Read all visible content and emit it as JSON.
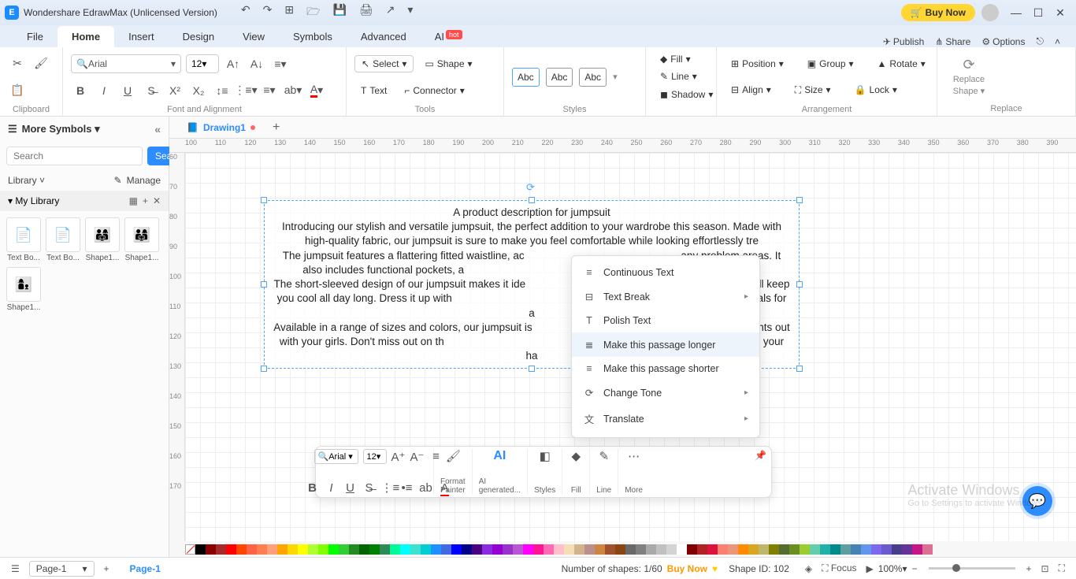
{
  "titlebar": {
    "app_title": "Wondershare EdrawMax (Unlicensed Version)",
    "buy_now": "Buy Now"
  },
  "menu": {
    "tabs": [
      "File",
      "Home",
      "Insert",
      "Design",
      "View",
      "Symbols",
      "Advanced",
      "AI"
    ],
    "active_index": 1,
    "hot_index": 7,
    "publish": "Publish",
    "share": "Share",
    "options": "Options"
  },
  "ribbon": {
    "clipboard": "Clipboard",
    "font_align": "Font and Alignment",
    "tools": "Tools",
    "styles": "Styles",
    "arrangement": "Arrangement",
    "replace_grp": "Replace",
    "font_name": "Arial",
    "font_size": "12",
    "select": "Select",
    "shape": "Shape",
    "text": "Text",
    "connector": "Connector",
    "abc": "Abc",
    "fill": "Fill",
    "line": "Line",
    "shadow": "Shadow",
    "position": "Position",
    "align": "Align",
    "group": "Group",
    "size": "Size",
    "rotate": "Rotate",
    "lock": "Lock",
    "replace_shape_l1": "Replace",
    "replace_shape_l2": "Shape"
  },
  "left_panel": {
    "title": "More Symbols",
    "search_btn": "Search",
    "search_placeholder": "Search",
    "library": "Library",
    "manage": "Manage",
    "my_library": "My Library",
    "thumbs": [
      "Text Bo...",
      "Text Bo...",
      "Shape1...",
      "Shape1...",
      "Shape1..."
    ]
  },
  "doc_tabs": {
    "name": "Drawing1"
  },
  "ruler_h": [
    "100",
    "110",
    "120",
    "130",
    "140",
    "150",
    "160",
    "170",
    "180",
    "190",
    "200",
    "210",
    "220",
    "230",
    "240",
    "250",
    "260",
    "270",
    "280",
    "290",
    "300",
    "310",
    "320",
    "330",
    "340",
    "350",
    "360",
    "370",
    "380",
    "390"
  ],
  "ruler_v": [
    "60",
    "70",
    "80",
    "90",
    "100",
    "110",
    "120",
    "130",
    "140",
    "150",
    "160",
    "170"
  ],
  "text_content": {
    "title": "A product description for jumpsuit",
    "p1": "Introducing our stylish and versatile jumpsuit, the perfect addition to your wardrobe this season. Made with high-quality fabric, our jumpsuit is sure to make you feel comfortable while looking effortlessly tre",
    "p2": "The jumpsuit features a flattering fitted waistline, ac                                                     any problem areas. It also includes functional pockets, a                                                  tials without having to lug aroun",
    "p3": "The short-sleeved design of our jumpsuit makes it ide                                                    hable material will keep you cool all day long. Dress it up with                                                 ght out or keep it casual with sandals for a",
    "p4": "Available in a range of sizes and colors, our jumpsuit is                                                  pping trips to nights out with your girls. Don't miss out on th                                                   and comfort to your wardrobe – get your ha"
  },
  "ctx_menu": {
    "continuous": "Continuous Text",
    "text_break": "Text Break",
    "polish": "Polish Text",
    "longer": "Make this passage longer",
    "shorter": "Make this passage shorter",
    "change_tone": "Change Tone",
    "translate": "Translate"
  },
  "float_tb": {
    "font": "Arial",
    "size": "12",
    "format_painter": "Format\nPainter",
    "ai_gen": "AI\ngenerated...",
    "styles": "Styles",
    "fill": "Fill",
    "line": "Line",
    "more": "More"
  },
  "statusbar": {
    "page_sel": "Page-1",
    "page_tab": "Page-1",
    "shapes_count": "Number of shapes: 1/60",
    "buy_now": "Buy Now",
    "shape_id": "Shape ID: 102",
    "focus": "Focus",
    "zoom": "100%"
  },
  "watermark": {
    "l1": "Activate Windows",
    "l2": "Go to Settings to activate Windows."
  },
  "colors": [
    "#000000",
    "#8B0000",
    "#A52A2A",
    "#FF0000",
    "#FF4500",
    "#FF6347",
    "#FF7F50",
    "#FFA07A",
    "#FFA500",
    "#FFD700",
    "#FFFF00",
    "#ADFF2F",
    "#7FFF00",
    "#00FF00",
    "#32CD32",
    "#228B22",
    "#006400",
    "#008000",
    "#2E8B57",
    "#00FA9A",
    "#00FFFF",
    "#40E0D0",
    "#00CED1",
    "#1E90FF",
    "#4169E1",
    "#0000FF",
    "#00008B",
    "#4B0082",
    "#8A2BE2",
    "#9400D3",
    "#9932CC",
    "#BA55D3",
    "#FF00FF",
    "#FF1493",
    "#FF69B4",
    "#FFC0CB",
    "#F5DEB3",
    "#D2B48C",
    "#BC8F8F",
    "#CD853F",
    "#A0522D",
    "#8B4513",
    "#696969",
    "#808080",
    "#A9A9A9",
    "#C0C0C0",
    "#D3D3D3",
    "#FFFFFF",
    "#800000",
    "#B22222",
    "#DC143C",
    "#FA8072",
    "#E9967A",
    "#FF8C00",
    "#DAA520",
    "#BDB76B",
    "#808000",
    "#556B2F",
    "#6B8E23",
    "#9ACD32",
    "#66CDAA",
    "#20B2AA",
    "#008B8B",
    "#5F9EA0",
    "#4682B4",
    "#6495ED",
    "#7B68EE",
    "#6A5ACD",
    "#483D8B",
    "#663399",
    "#C71585",
    "#DB7093"
  ]
}
